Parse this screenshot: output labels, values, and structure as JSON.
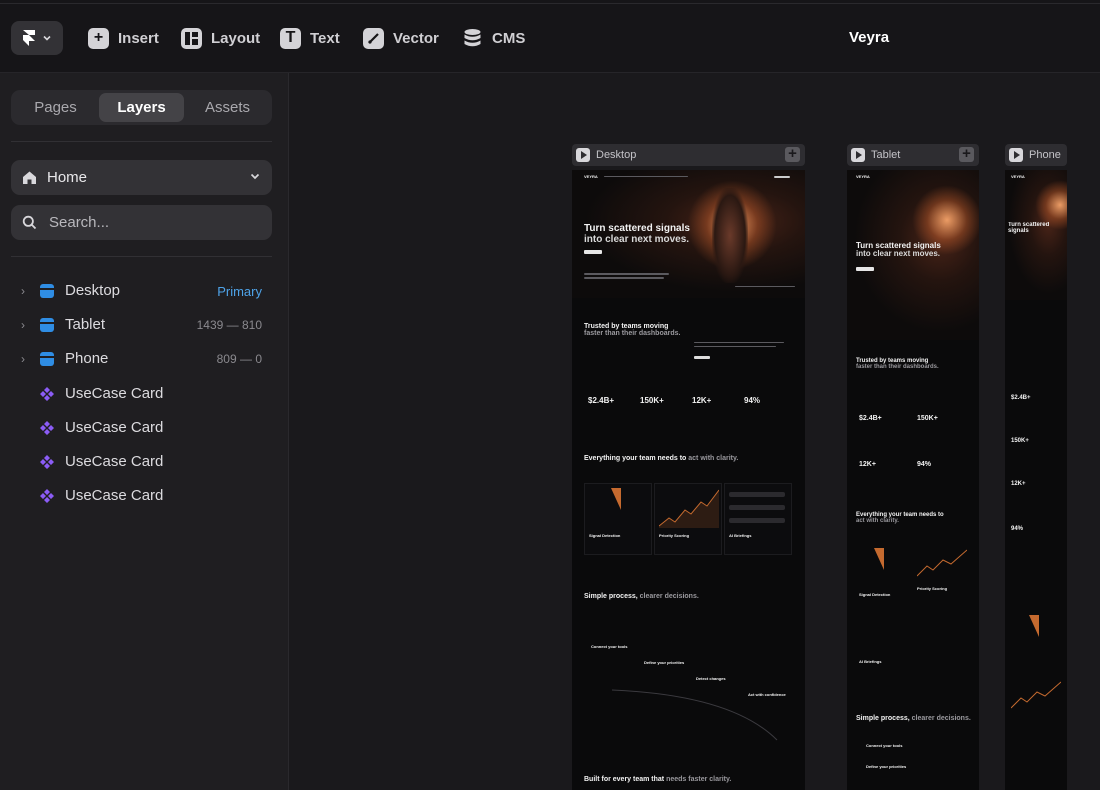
{
  "toolbar": {
    "insert_label": "Insert",
    "layout_label": "Layout",
    "text_label": "Text",
    "vector_label": "Vector",
    "cms_label": "CMS",
    "project_title": "Veyra"
  },
  "sidebar": {
    "tabs": [
      "Pages",
      "Layers",
      "Assets"
    ],
    "active_tab": "Layers",
    "page_select": "Home",
    "search_placeholder": "Search...",
    "layers": [
      {
        "name": "Desktop",
        "meta": "Primary",
        "type": "breakpoint"
      },
      {
        "name": "Tablet",
        "meta": "1439 — 810",
        "type": "breakpoint"
      },
      {
        "name": "Phone",
        "meta": "809 — 0",
        "type": "breakpoint"
      },
      {
        "name": "UseCase Card",
        "meta": "",
        "type": "component"
      },
      {
        "name": "UseCase Card",
        "meta": "",
        "type": "component"
      },
      {
        "name": "UseCase Card",
        "meta": "",
        "type": "component"
      },
      {
        "name": "UseCase Card",
        "meta": "",
        "type": "component"
      }
    ]
  },
  "canvas": {
    "frames": [
      {
        "label": "Desktop"
      },
      {
        "label": "Tablet"
      },
      {
        "label": "Phone"
      }
    ],
    "site": {
      "brand": "VEYRA",
      "hero_title": "Turn scattered signals",
      "hero_title_2": "into clear next moves.",
      "trusted_title": "Trusted by teams moving",
      "trusted_title_dim": "faster than their dashboards.",
      "stats": [
        "$2.4B+",
        "150K+",
        "12K+",
        "94%"
      ],
      "features_title": "Everything your team needs to",
      "features_title_dim": "act with clarity.",
      "feature_cards": [
        "Signal Detection",
        "Priority Scoring",
        "AI Briefings"
      ],
      "process_title": "Simple process,",
      "process_title_dim": "clearer decisions.",
      "process_steps": [
        "Connect your tools",
        "Define your priorities",
        "Detect changes",
        "Act with confidence"
      ],
      "built_title": "Built for every team that",
      "built_title_dim": "needs faster clarity."
    }
  },
  "colors": {
    "accent_blue": "#2f8de4",
    "component_purple": "#8b5cf6",
    "hero_orange": "#c56a2f"
  }
}
